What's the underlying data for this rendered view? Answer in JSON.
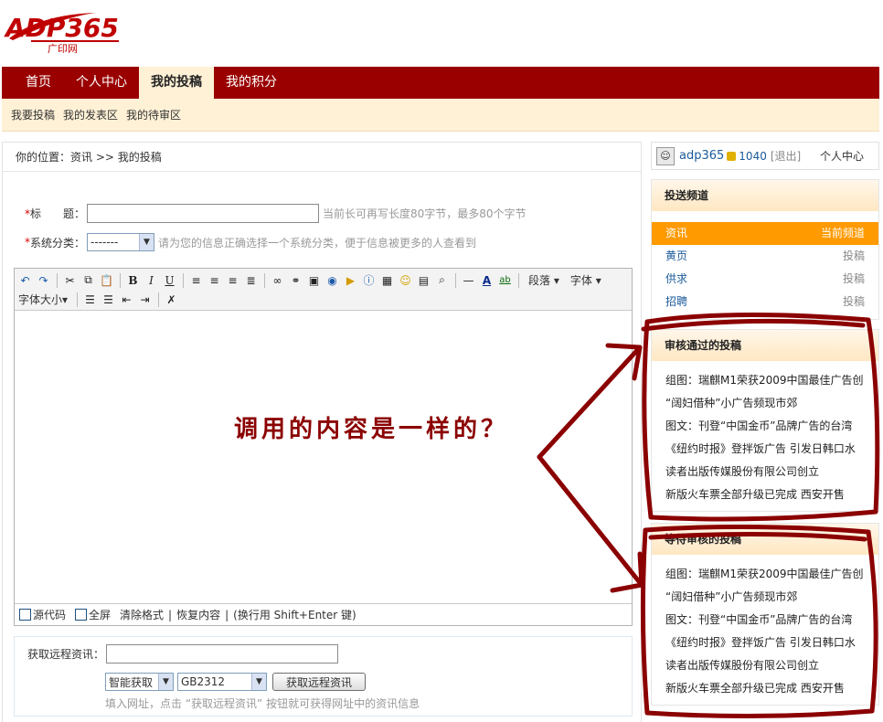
{
  "logo": {
    "text": "ADP365",
    "sub": "广印网"
  },
  "nav": {
    "items": [
      "首页",
      "个人中心",
      "我的投稿",
      "我的积分"
    ],
    "active": 2
  },
  "subnav": {
    "items": [
      "我要投稿",
      "我的发表区",
      "我的待审区"
    ]
  },
  "breadcrumb": "你的位置：资讯  >> 我的投稿",
  "form": {
    "title_req": "*",
    "title_label": "标　　题：",
    "title_value": "",
    "title_hint": "当前长可再写长度80字节，最多80个字节",
    "category_req": "*",
    "category_label": "系统分类：",
    "category_selected": "-------",
    "category_hint": "请为您的信息正确选择一个系统分类，便于信息被更多的人查看到"
  },
  "editor": {
    "toolbar_dropdowns": [
      "段落",
      "字体",
      "字体大小"
    ],
    "overlay_annotation": "调用的内容是一样的？",
    "footer": {
      "source_label": "源代码",
      "fullscreen_label": "全屏",
      "clear_format": "清除格式",
      "restore": "恢复内容",
      "newline_hint": "(换行用 Shift+Enter 键)"
    }
  },
  "remote": {
    "label": "获取远程资讯：",
    "url_value": "",
    "mode_selected": "智能获取",
    "encoding_selected": "GB2312",
    "fetch_button": "获取远程资讯",
    "hint": "填入网址，点击 “获取远程资讯” 按钮就可获得网址中的资讯信息"
  },
  "sidebar": {
    "user": {
      "name": "adp365",
      "points": "1040",
      "logout": "[退出]",
      "center": "个人中心"
    },
    "channels": {
      "title": "投送频道",
      "items": [
        {
          "name": "资讯",
          "status": "当前频道",
          "active": true
        },
        {
          "name": "黄页",
          "status": "投稿"
        },
        {
          "name": "供求",
          "status": "投稿"
        },
        {
          "name": "招聘",
          "status": "投稿"
        }
      ]
    },
    "approved": {
      "title": "审核通过的投稿",
      "items": [
        "组图：瑞麒M1荣获2009中国最佳广告创",
        "“阔妇借种”小广告频现市郊",
        "图文：刊登“中国金币”品牌广告的台湾",
        "《纽约时报》登拌饭广告 引发日韩口水",
        "读者出版传媒股份有限公司创立",
        "新版火车票全部升级已完成 西安开售"
      ]
    },
    "pending": {
      "title": "等待审核的投稿",
      "items": [
        "组图：瑞麒M1荣获2009中国最佳广告创",
        "“阔妇借种”小广告频现市郊",
        "图文：刊登“中国金币”品牌广告的台湾",
        "《纽约时报》登拌饭广告 引发日韩口水",
        "读者出版传媒股份有限公司创立",
        "新版火车票全部升级已完成 西安开售"
      ]
    }
  },
  "colors": {
    "brand": "#9a0000",
    "subnav_bg": "#fff1d6",
    "active_channel": "#ff9a00",
    "annotation": "#8b0000"
  }
}
